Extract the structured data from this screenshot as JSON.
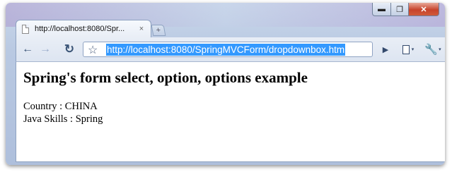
{
  "window": {
    "controls": {
      "minimize": "▬",
      "maximize": "❐",
      "close": "✕"
    }
  },
  "tab": {
    "title": "http://localhost:8080/Spr...",
    "close_glyph": "×"
  },
  "new_tab_glyph": "+",
  "toolbar": {
    "back_glyph": "←",
    "forward_glyph": "→",
    "reload_glyph": "↻",
    "bookmark_glyph": "☆",
    "url": "http://localhost:8080/SpringMVCForm/dropdownbox.htm",
    "go_glyph": "▶",
    "menu_caret": "▾",
    "wrench_glyph": "🔧"
  },
  "page": {
    "heading": "Spring's form select, option, options example",
    "country": "Country : CHINA",
    "java_skills": "Java Skills : Spring"
  }
}
